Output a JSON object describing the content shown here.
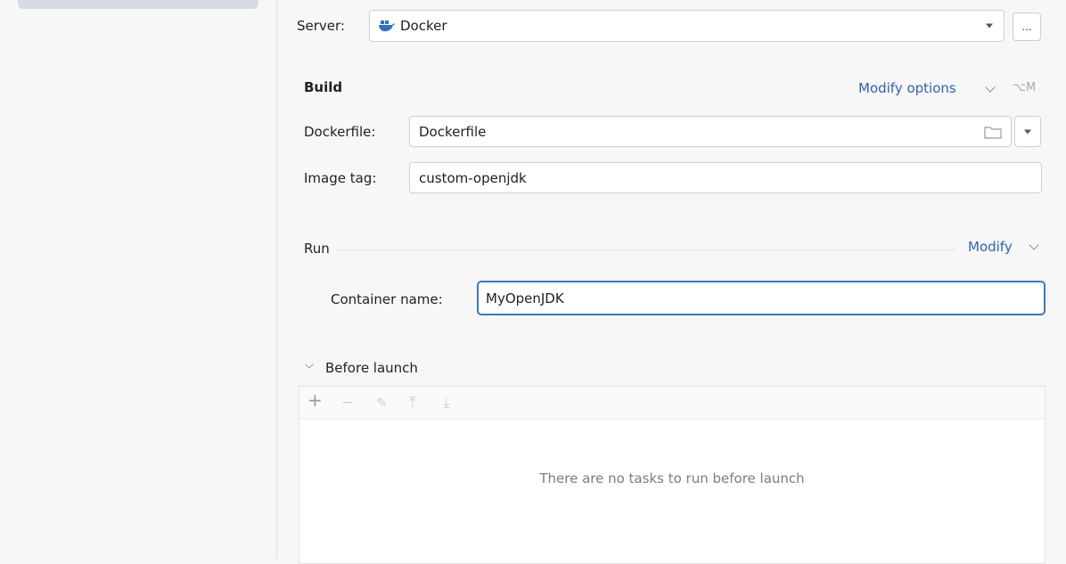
{
  "server": {
    "label": "Server:",
    "value": "Docker",
    "more_button": "..."
  },
  "build": {
    "heading": "Build",
    "modify_options": "Modify options",
    "modify_shortcut": "⌥M",
    "dockerfile_label": "Dockerfile:",
    "dockerfile_value": "Dockerfile",
    "image_tag_label": "Image tag:",
    "image_tag_value": "custom-openjdk"
  },
  "run": {
    "heading": "Run",
    "modify": "Modify",
    "container_name_label": "Container name:",
    "container_name_value": "MyOpenJDK"
  },
  "before_launch": {
    "heading": "Before launch",
    "empty_text": "There are no tasks to run before launch",
    "toolbar": {
      "add": "+",
      "remove": "−",
      "edit": "✎",
      "move_up": "⤒",
      "move_down": "⤓"
    }
  },
  "colors": {
    "accent": "#2f64b5",
    "focus": "#3a75c4",
    "docker": "#2f6fd1"
  }
}
